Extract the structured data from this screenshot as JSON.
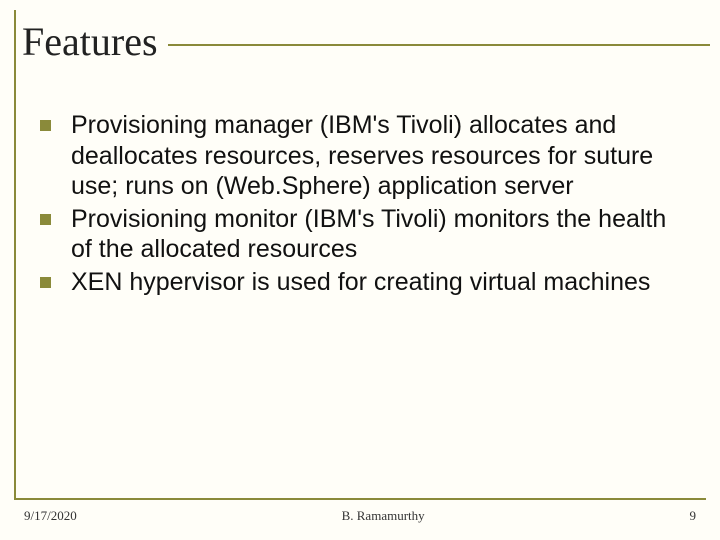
{
  "title": "Features",
  "bullets": [
    "Provisioning manager (IBM's Tivoli) allocates and deallocates resources, reserves resources for suture use; runs on (Web.Sphere) application server",
    "Provisioning monitor (IBM's Tivoli) monitors the health of the allocated resources",
    "XEN hypervisor is used for creating virtual machines"
  ],
  "footer": {
    "date": "9/17/2020",
    "author": "B. Ramamurthy",
    "page": "9"
  },
  "colors": {
    "accent": "#8a8a3a",
    "background": "#fffef8"
  }
}
